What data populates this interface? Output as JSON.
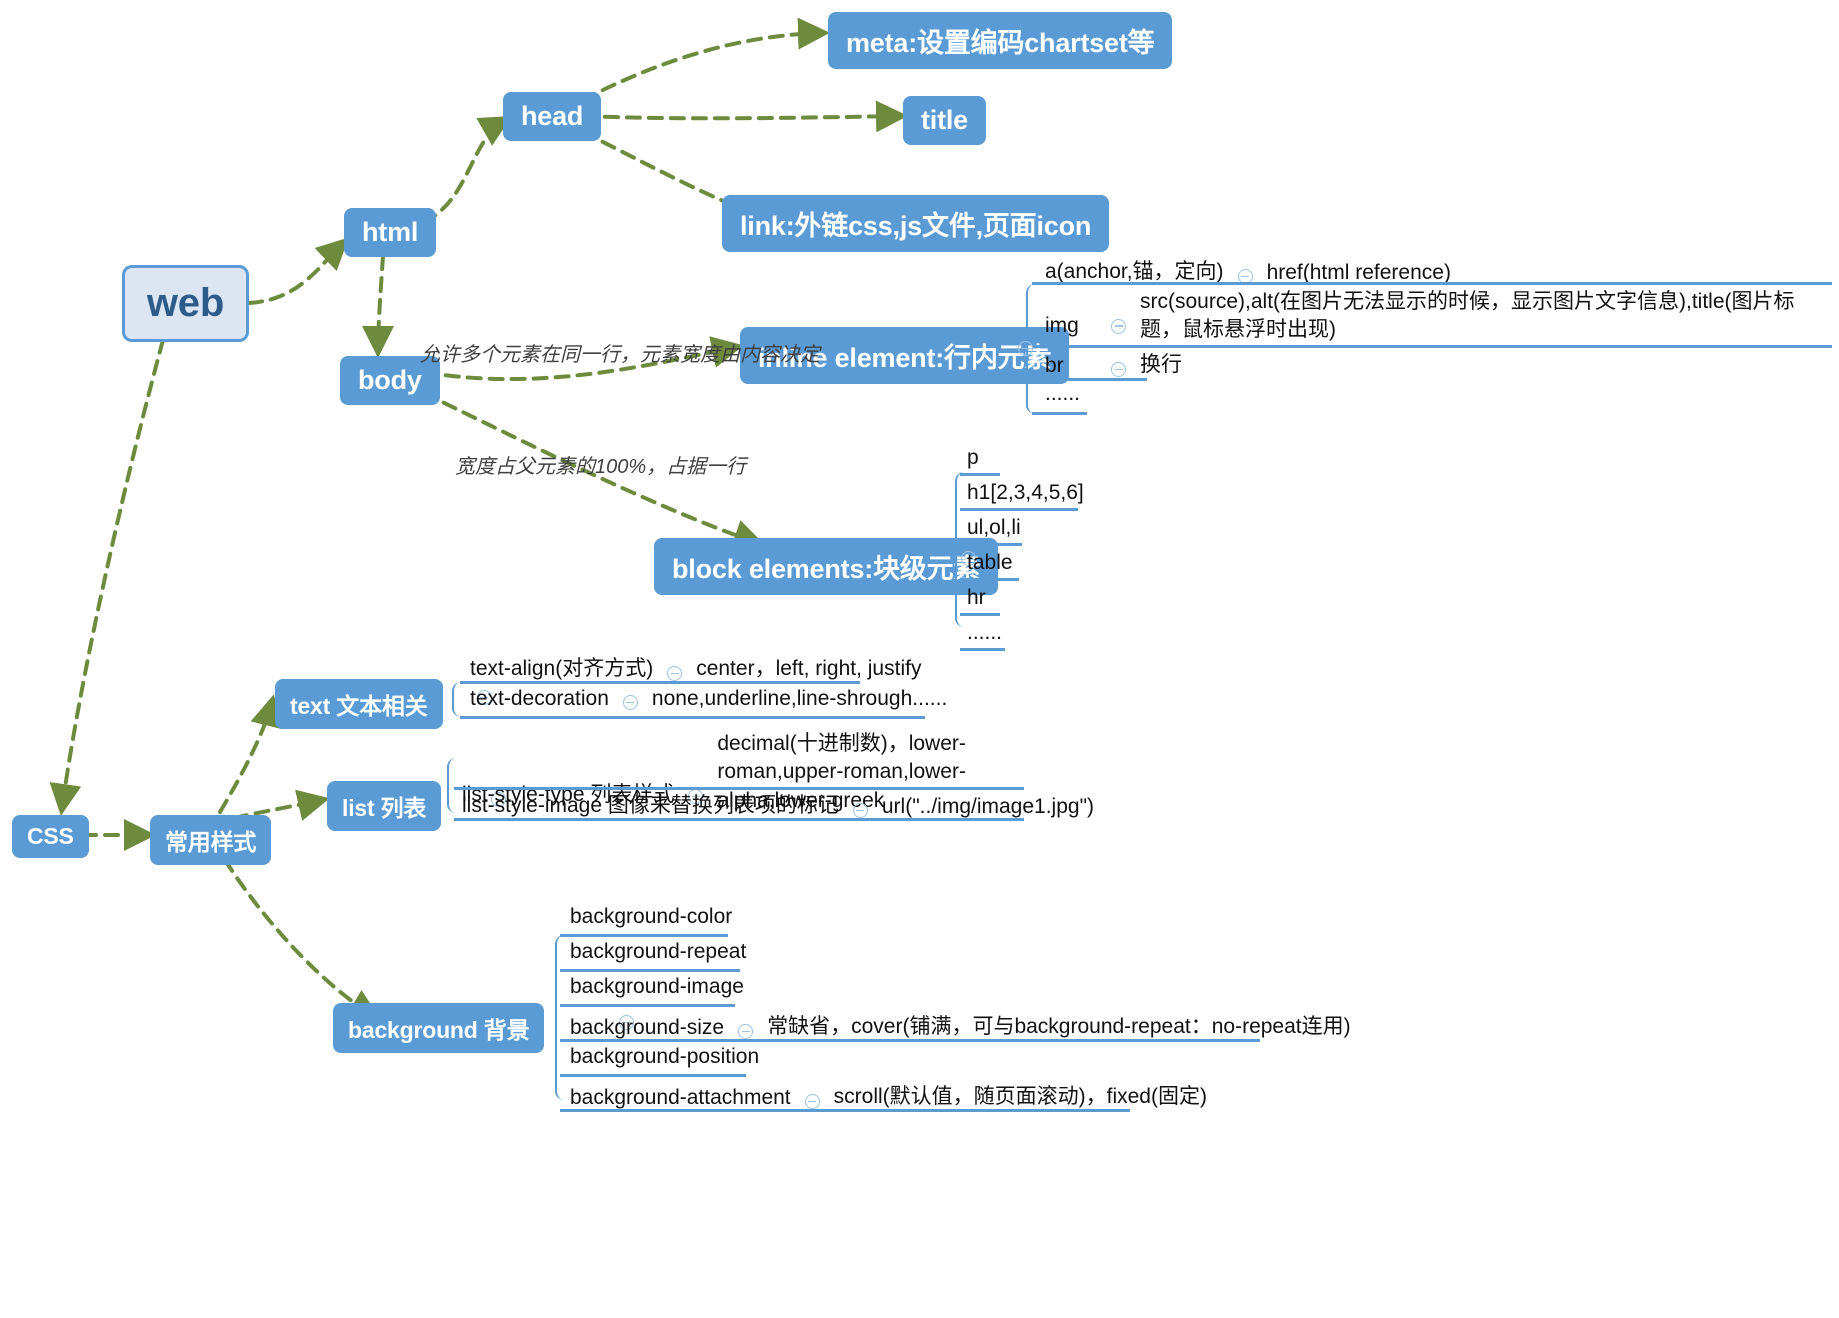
{
  "diagram": {
    "title": "web",
    "theme": {
      "node_fill": "#5b9bd5",
      "root_fill": "#dce6f2",
      "edge_color": "#70893a",
      "underline": "#5b9bd5",
      "text": "#111111"
    }
  },
  "nodes": {
    "root": "web",
    "html": "html",
    "head": "head",
    "body": "body",
    "css": "CSS",
    "common_styles": "常用样式",
    "meta": "meta:设置编码chartset等",
    "title": "title",
    "link": "link:外链css,js文件,页面icon",
    "inline": "inline element:行内元素",
    "block": "block elements:块级元素",
    "text": "text 文本相关",
    "list": "list 列表",
    "background": "background 背景"
  },
  "edge_notes": {
    "inline": "允许多个元素在同一行，元素宽度由内容决定",
    "block": "宽度占父元素的100%，占据一行"
  },
  "inline_children": [
    {
      "label": "a(anchor,锚，定向)",
      "has_collapse": true,
      "value": "href(html reference)"
    },
    {
      "label": "img",
      "has_collapse": true,
      "value": "src(source),alt(在图片无法显示的时候，显示图片文字信息),title(图片标题，鼠标悬浮时出现)"
    },
    {
      "label": "br",
      "has_collapse": true,
      "value": "换行"
    },
    {
      "label": "......",
      "has_collapse": false,
      "value": ""
    }
  ],
  "block_children": [
    {
      "label": "p"
    },
    {
      "label": "h1[2,3,4,5,6]"
    },
    {
      "label": "ul,ol,li"
    },
    {
      "label": "table"
    },
    {
      "label": "hr"
    },
    {
      "label": "......"
    }
  ],
  "text_children": [
    {
      "label": "text-align(对齐方式)",
      "has_collapse": true,
      "value": "center，left, right, justify"
    },
    {
      "label": "text-decoration",
      "has_collapse": true,
      "value": "none,underline,line-shrough......"
    }
  ],
  "list_children": [
    {
      "label": "list-style-type 列表样式",
      "has_collapse": true,
      "value": "decimal(十进制数)，lower-roman,upper-roman,lower-alpha,lower-greek"
    },
    {
      "label": "list-style-image 图像来替换列表项的标记",
      "has_collapse": true,
      "value": "url(\"../img/image1.jpg\")"
    }
  ],
  "background_children": [
    {
      "label": "background-color",
      "has_collapse": false,
      "value": ""
    },
    {
      "label": "background-repeat",
      "has_collapse": false,
      "value": ""
    },
    {
      "label": "background-image",
      "has_collapse": false,
      "value": ""
    },
    {
      "label": "background-size",
      "has_collapse": true,
      "value": "常缺省，cover(铺满，可与background-repeat：no-repeat连用)"
    },
    {
      "label": "background-position",
      "has_collapse": false,
      "value": ""
    },
    {
      "label": "background-attachment",
      "has_collapse": true,
      "value": "scroll(默认值，随页面滚动)，fixed(固定)"
    }
  ]
}
